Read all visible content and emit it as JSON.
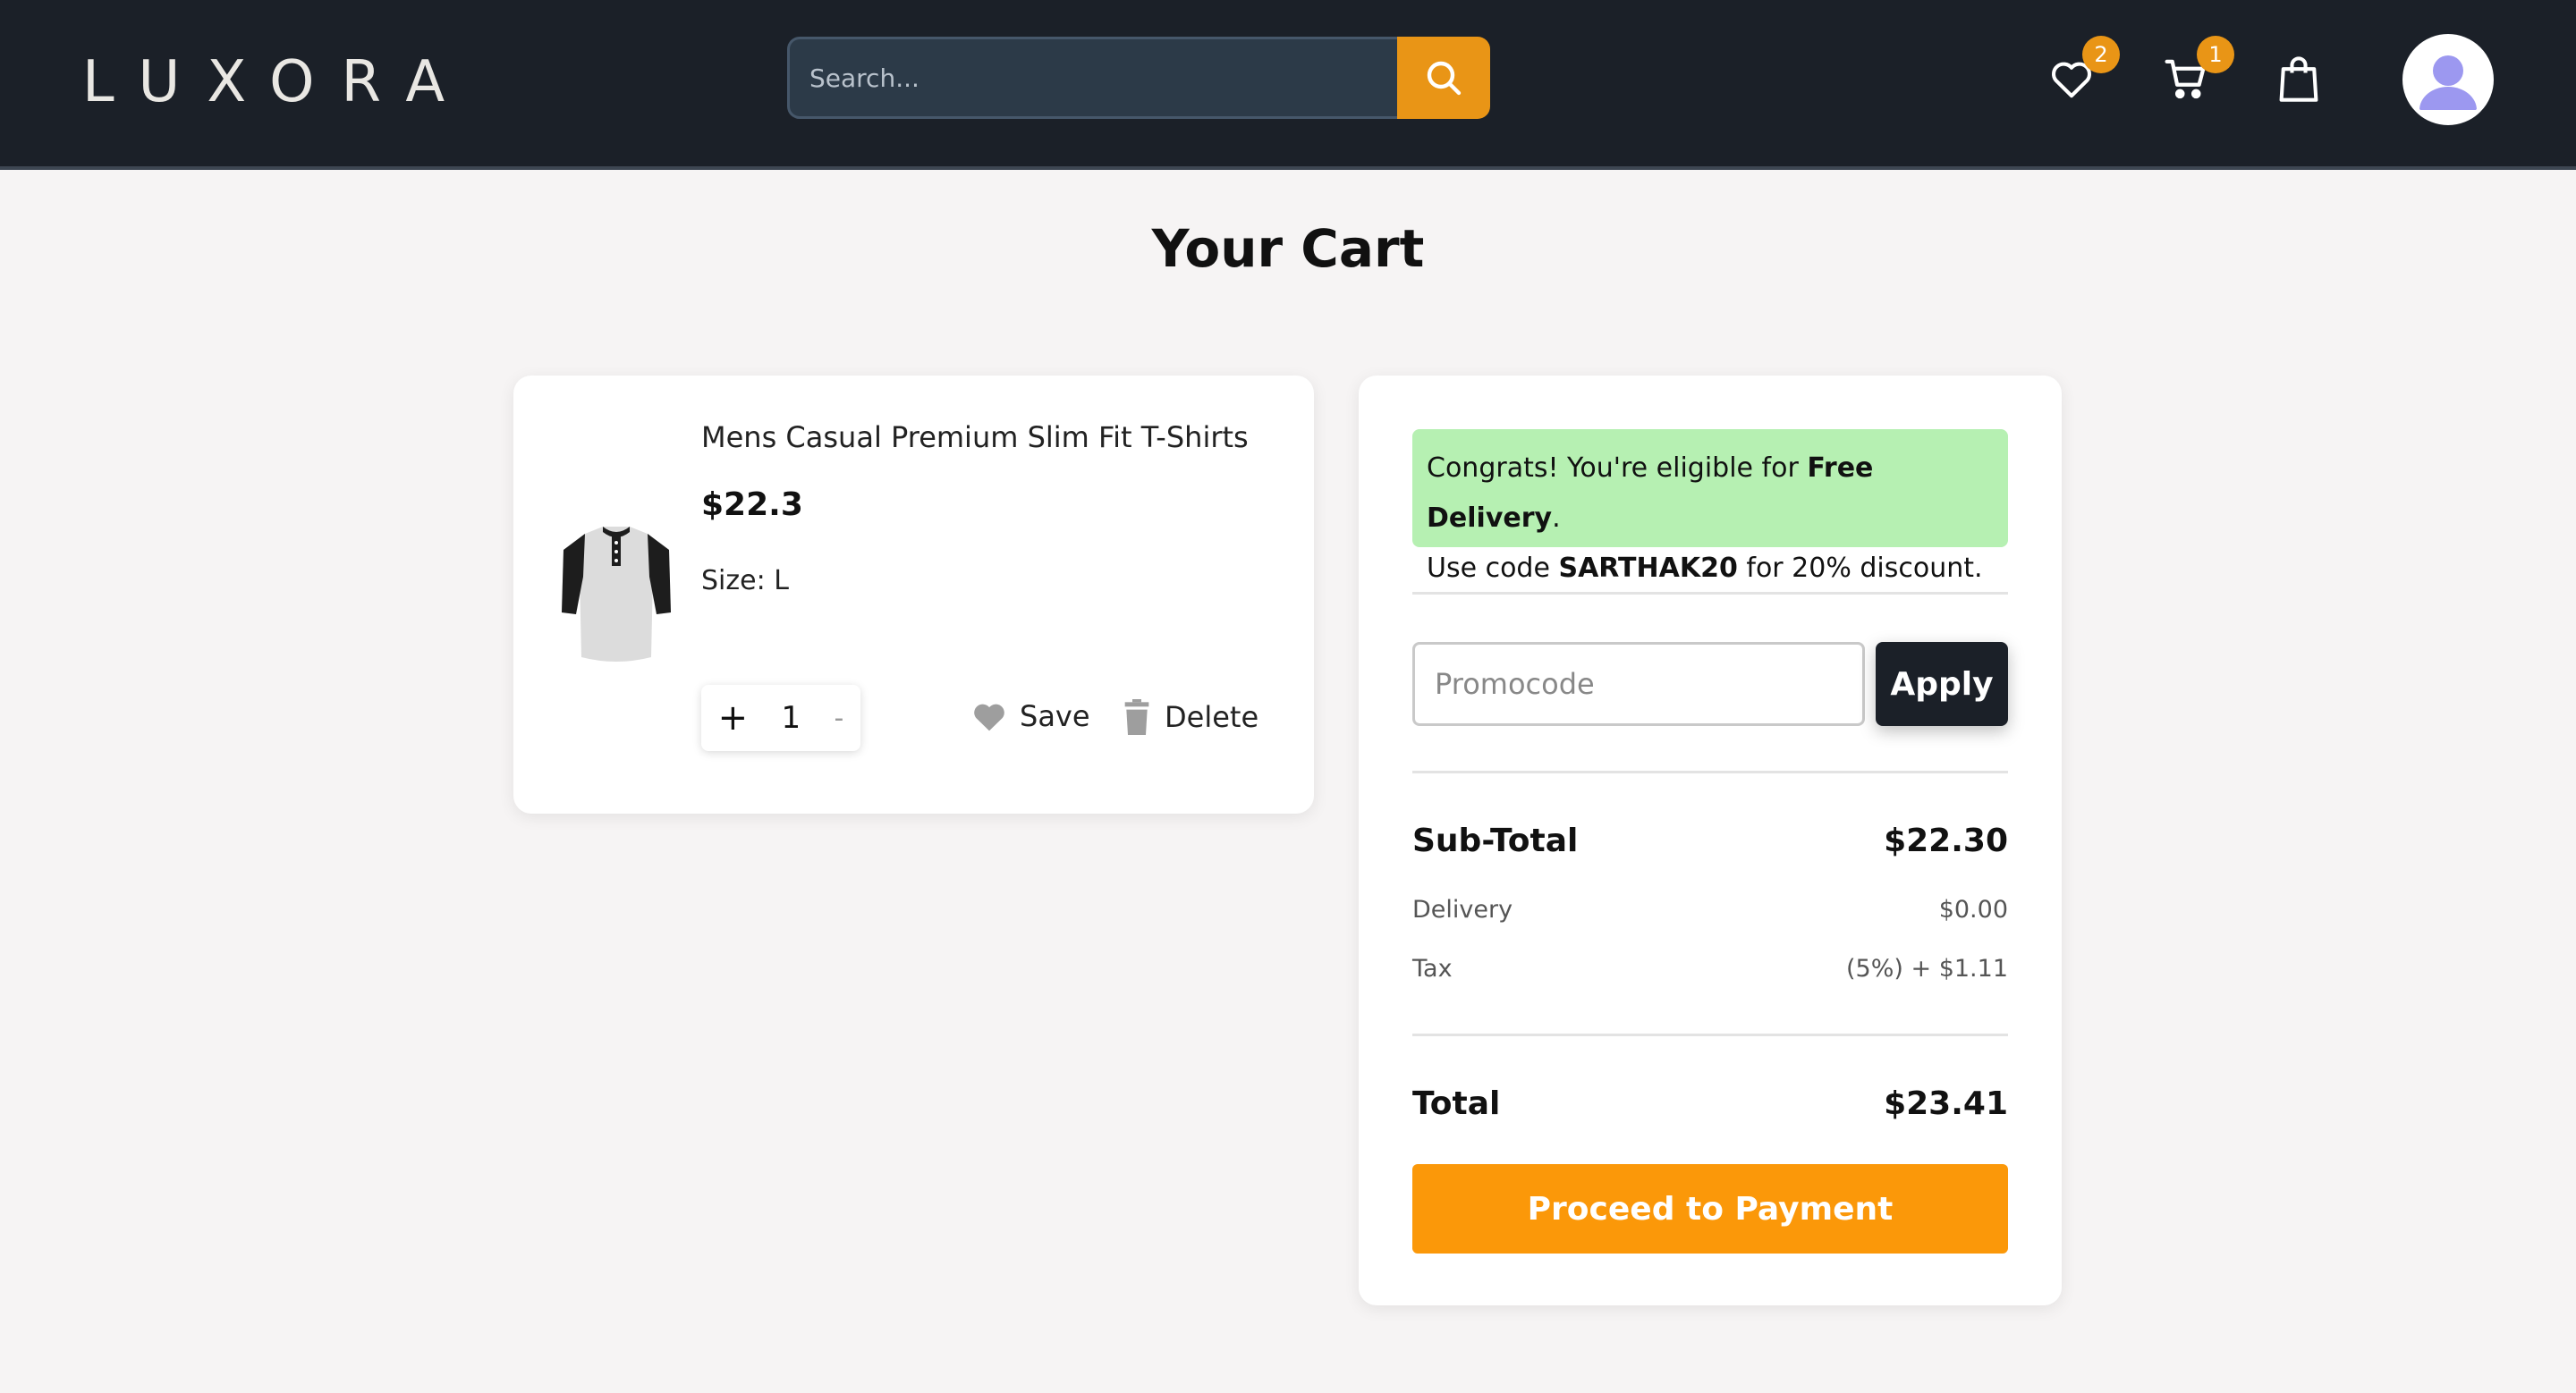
{
  "header": {
    "logo": "LUXORA",
    "search_placeholder": "Search...",
    "wishlist_count": "2",
    "cart_count": "1"
  },
  "page": {
    "title": "Your Cart"
  },
  "cart_item": {
    "name": "Mens Casual Premium Slim Fit T-Shirts",
    "price": "$22.3",
    "size": "Size: L",
    "quantity": "1",
    "plus_label": "+",
    "minus_label": "-",
    "save_label": "Save",
    "delete_label": "Delete"
  },
  "summary": {
    "banner_line1_prefix": "Congrats! You're eligible for ",
    "banner_line1_bold": "Free Delivery",
    "banner_line1_suffix": ".",
    "banner_line2_prefix": "Use code ",
    "banner_line2_bold": "SARTHAK20",
    "banner_line2_suffix": " for 20% discount.",
    "promo_placeholder": "Promocode",
    "apply_label": "Apply",
    "subtotal_label": "Sub-Total",
    "subtotal_value": "$22.30",
    "delivery_label": "Delivery",
    "delivery_value": "$0.00",
    "tax_label": "Tax",
    "tax_value": "(5%) + $1.11",
    "total_label": "Total",
    "total_value": "$23.41",
    "pay_label": "Proceed to Payment"
  },
  "colors": {
    "header_bg": "#1b2028",
    "accent": "#e99516",
    "pay_button": "#fb9809",
    "banner_bg": "#b6f0b2"
  },
  "icons": [
    "search-icon",
    "heart-icon",
    "cart-icon",
    "bag-icon",
    "user-avatar-icon",
    "trash-icon"
  ]
}
